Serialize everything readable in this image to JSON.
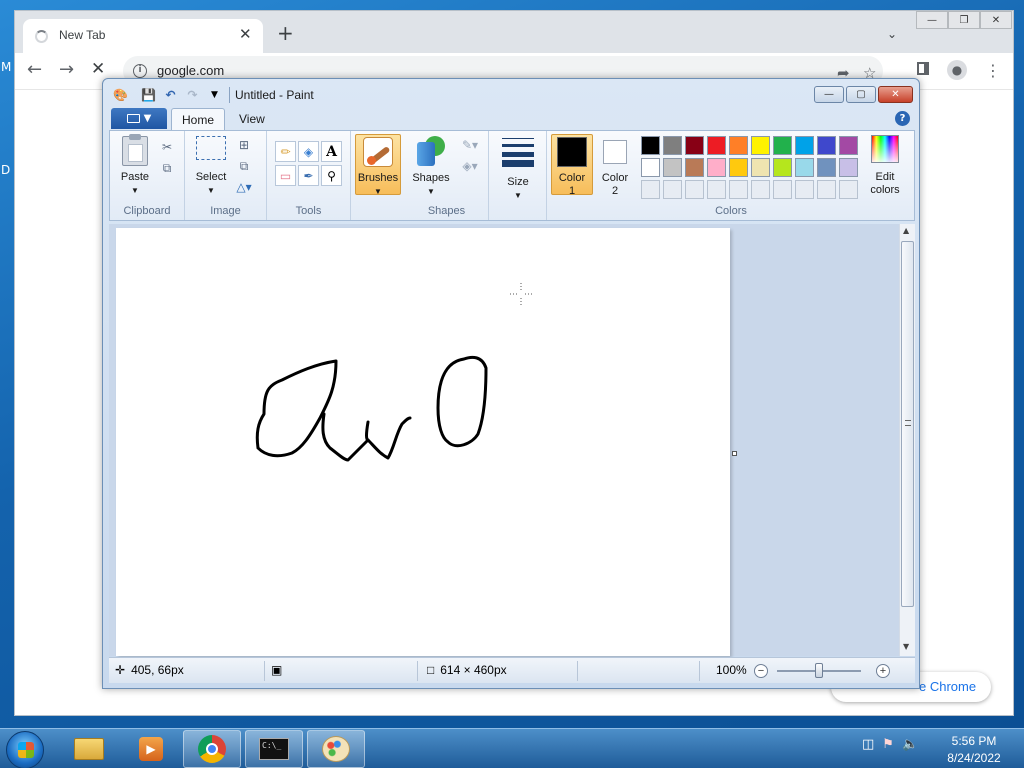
{
  "desktop": {
    "edge_text_1": "M",
    "edge_text_2": "D"
  },
  "chrome": {
    "tab_title": "New Tab",
    "tab_close": "✕",
    "new_tab": "+",
    "url": "google.com",
    "toast_text": "e Chrome"
  },
  "paint": {
    "window_title": "Untitled - Paint",
    "tabs": {
      "home": "Home",
      "view": "View"
    },
    "groups": {
      "clipboard": "Clipboard",
      "image": "Image",
      "tools": "Tools",
      "shapes": "Shapes",
      "colors": "Colors"
    },
    "buttons": {
      "paste": "Paste",
      "select": "Select",
      "brushes": "Brushes",
      "shapes": "Shapes",
      "size": "Size",
      "color1_line1": "Color",
      "color1_line2": "1",
      "color2_line1": "Color",
      "color2_line2": "2",
      "edit_colors_line1": "Edit",
      "edit_colors_line2": "colors"
    },
    "color1": "#000000",
    "color2": "#ffffff",
    "palette_row1": [
      "#000000",
      "#7f7f7f",
      "#880015",
      "#ed1c24",
      "#ff7f27",
      "#fff200",
      "#22b14c",
      "#00a2e8",
      "#3f48cc",
      "#a349a4"
    ],
    "palette_row2": [
      "#ffffff",
      "#c3c3c3",
      "#b97a57",
      "#ffaec9",
      "#ffc90e",
      "#efe4b0",
      "#b5e61d",
      "#99d9ea",
      "#7092be",
      "#c8bfe7"
    ],
    "status": {
      "cursor_pos": "405, 66px",
      "canvas_size": "614 × 460px",
      "zoom": "100%"
    }
  },
  "taskbar": {
    "clock_time": "5:56 PM",
    "clock_date": "8/24/2022"
  }
}
